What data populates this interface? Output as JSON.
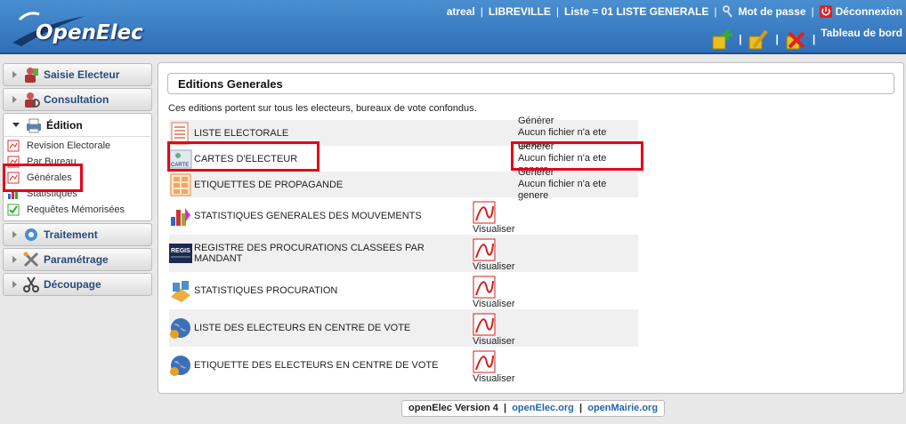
{
  "header": {
    "logo_text": "OpenElec",
    "user": "atreal",
    "city": "LIBREVILLE",
    "list": "Liste = 01 LISTE GENERALE",
    "password_label": "Mot de passe",
    "logout_label": "Déconnexion",
    "dashboard_label": "Tableau de bord"
  },
  "sidebar": {
    "menus": [
      {
        "label": "Saisie Electeur",
        "icon": "voter-entry-icon"
      },
      {
        "label": "Consultation",
        "icon": "consultation-icon"
      },
      {
        "label": "Édition",
        "icon": "printer-icon"
      }
    ],
    "edition_items": [
      "Revision Electorale",
      "Par Bureau",
      "Générales",
      "Statistiques",
      "Requêtes Mémorisées"
    ],
    "menus_after": [
      {
        "label": "Traitement",
        "icon": "gear-icon"
      },
      {
        "label": "Paramétrage",
        "icon": "tools-icon"
      },
      {
        "label": "Découpage",
        "icon": "scissors-icon"
      }
    ]
  },
  "main": {
    "title": "Editions Generales",
    "intro": "Ces editions portent sur tous les electeurs, bureaux de vote confondus.",
    "generate_label": "Générer",
    "no_file_label": "Aucun fichier n'a ete genere",
    "view_label": "Visualiser",
    "rows": [
      {
        "label": "LISTE ELECTORALE",
        "icon": "list-document-icon",
        "action": "generate"
      },
      {
        "label": "CARTES D'ELECTEUR",
        "icon": "voter-card-icon",
        "icon_text": "CARTE",
        "action": "generate"
      },
      {
        "label": "ETIQUETTES DE PROPAGANDE",
        "icon": "labels-icon",
        "action": "generate"
      },
      {
        "label": "STATISTIQUES GENERALES DES MOUVEMENTS",
        "icon": "statistics-icon",
        "action": "view"
      },
      {
        "label": "REGISTRE DES PROCURATIONS CLASSEES PAR MANDANT",
        "icon": "register-icon",
        "icon_text": "REGIS",
        "action": "view"
      },
      {
        "label": "STATISTIQUES PROCURATION",
        "icon": "proxy-statistics-icon",
        "action": "view"
      },
      {
        "label": "LISTE DES ELECTEURS EN CENTRE DE VOTE",
        "icon": "globe-icon",
        "action": "view"
      },
      {
        "label": "ETIQUETTE DES ELECTEURS EN CENTRE DE VOTE",
        "icon": "globe-icon",
        "action": "view"
      }
    ]
  },
  "footer": {
    "version": "openElec Version 4",
    "link1": "openElec.org",
    "link2": "openMairie.org"
  },
  "colors": {
    "header_blue": "#2f6fb8",
    "highlight_red": "#e3001b",
    "link_blue": "#2266aa"
  }
}
